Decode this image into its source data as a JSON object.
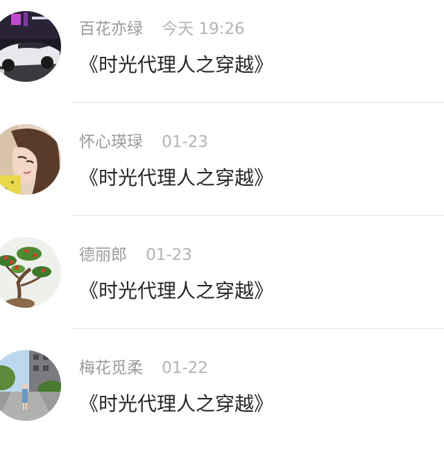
{
  "comments": [
    {
      "username": "百花亦绿",
      "time": "今天 19:26",
      "text": "《时光代理人之穿越》",
      "avatar_icon": "car-photo-avatar"
    },
    {
      "username": "怀心瑛琭",
      "time": "01-23",
      "text": "《时光代理人之穿越》",
      "avatar_icon": "portrait-photo-avatar"
    },
    {
      "username": "德丽郎",
      "time": "01-23",
      "text": "《时光代理人之穿越》",
      "avatar_icon": "bonsai-photo-avatar"
    },
    {
      "username": "梅花觅柔",
      "time": "01-22",
      "text": "《时光代理人之穿越》",
      "avatar_icon": "street-photo-avatar"
    }
  ],
  "colors": {
    "username": "#9a9a9a",
    "time": "#b3b3b3",
    "text": "#262626",
    "divider": "#eeeeee",
    "background": "#ffffff"
  }
}
